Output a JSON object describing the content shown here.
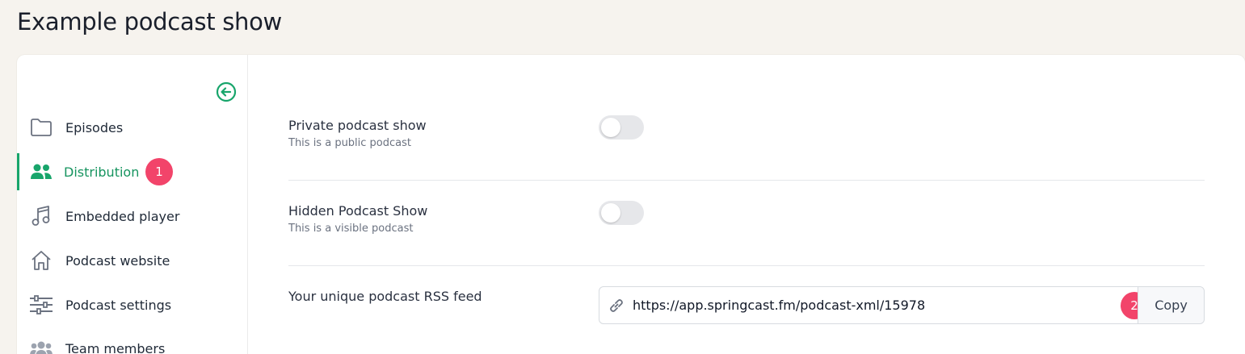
{
  "page": {
    "title": "Example podcast show"
  },
  "sidebar": {
    "collapse_icon": "arrow-left-circle-icon",
    "items": [
      {
        "label": "Episodes",
        "icon": "folder-icon",
        "active": false
      },
      {
        "label": "Distribution",
        "icon": "users-icon",
        "active": true,
        "badge": "1"
      },
      {
        "label": "Embedded player",
        "icon": "music-note-icon",
        "active": false
      },
      {
        "label": "Podcast website",
        "icon": "home-icon",
        "active": false
      },
      {
        "label": "Podcast settings",
        "icon": "sliders-icon",
        "active": false
      },
      {
        "label": "Team members",
        "icon": "team-icon",
        "active": false
      }
    ]
  },
  "settings": {
    "private": {
      "label": "Private podcast show",
      "sub": "This is a public podcast",
      "enabled": false
    },
    "hidden": {
      "label": "Hidden Podcast Show",
      "sub": "This is a visible podcast",
      "enabled": false
    },
    "rss": {
      "label": "Your unique podcast RSS feed",
      "url": "https://app.springcast.fm/podcast-xml/15978",
      "copy_label": "Copy",
      "badge": "2"
    }
  },
  "colors": {
    "accent": "#18a56b",
    "badge": "#f2446a",
    "background": "#f6f3ee"
  }
}
